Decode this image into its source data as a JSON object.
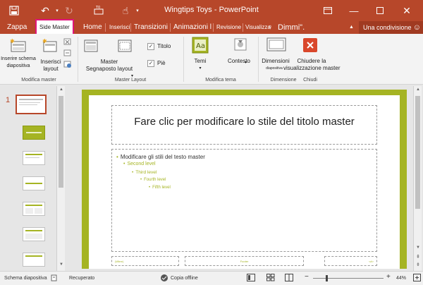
{
  "app": {
    "title": "Wingtips Toys - PowerPoint"
  },
  "tabs": {
    "file": "Zappa",
    "slide_master": "Side Master",
    "home": "Home",
    "insert": "Inserisci",
    "transitions": "Transizioni",
    "animations": "Animazioni l",
    "review": "Revisione",
    "view": "Visualizza",
    "tell_me": "Dimmi\".",
    "share": "Una condivisione"
  },
  "ribbon": {
    "insert_slide_master": "Inserire schema\ndiapositiva",
    "insert_layout": "Inserisci\nlayout",
    "master_layout_btn": "Master\nSegnaposto layout",
    "title_check": "Titolo",
    "footer_check": "Piè",
    "themes": "Temi",
    "context": "Contesto",
    "slide_size": "Dimensioni",
    "slide_size_sub": "diapositiva",
    "close_master": "Chiudere la\nvisualizzazione master",
    "groups": {
      "edit_master": "Modifica master",
      "master_layout": "Master Layout",
      "edit_theme": "Modifica tema",
      "size": "Dimensione",
      "close": "Chiudi"
    }
  },
  "thumbnails": {
    "first_number": "1"
  },
  "slide": {
    "title": "Fare clic per modificare lo stile del titolo master",
    "bullets": [
      "Modificare gli stili del testo master",
      "Second level",
      "Third level",
      "Fourth level",
      "Fifth level"
    ],
    "footer_left": "(Wbnr)",
    "footer_center": "Footer",
    "footer_right": "<#>"
  },
  "status": {
    "view_name": "Schema diapositiva",
    "recovered": "Recuperato",
    "offline": "Copia offline",
    "zoom": "44%"
  },
  "colors": {
    "accent": "#b7472a",
    "theme_green": "#a5b423",
    "close_red": "#d9472b",
    "active_tab_border": "#e0157a"
  }
}
